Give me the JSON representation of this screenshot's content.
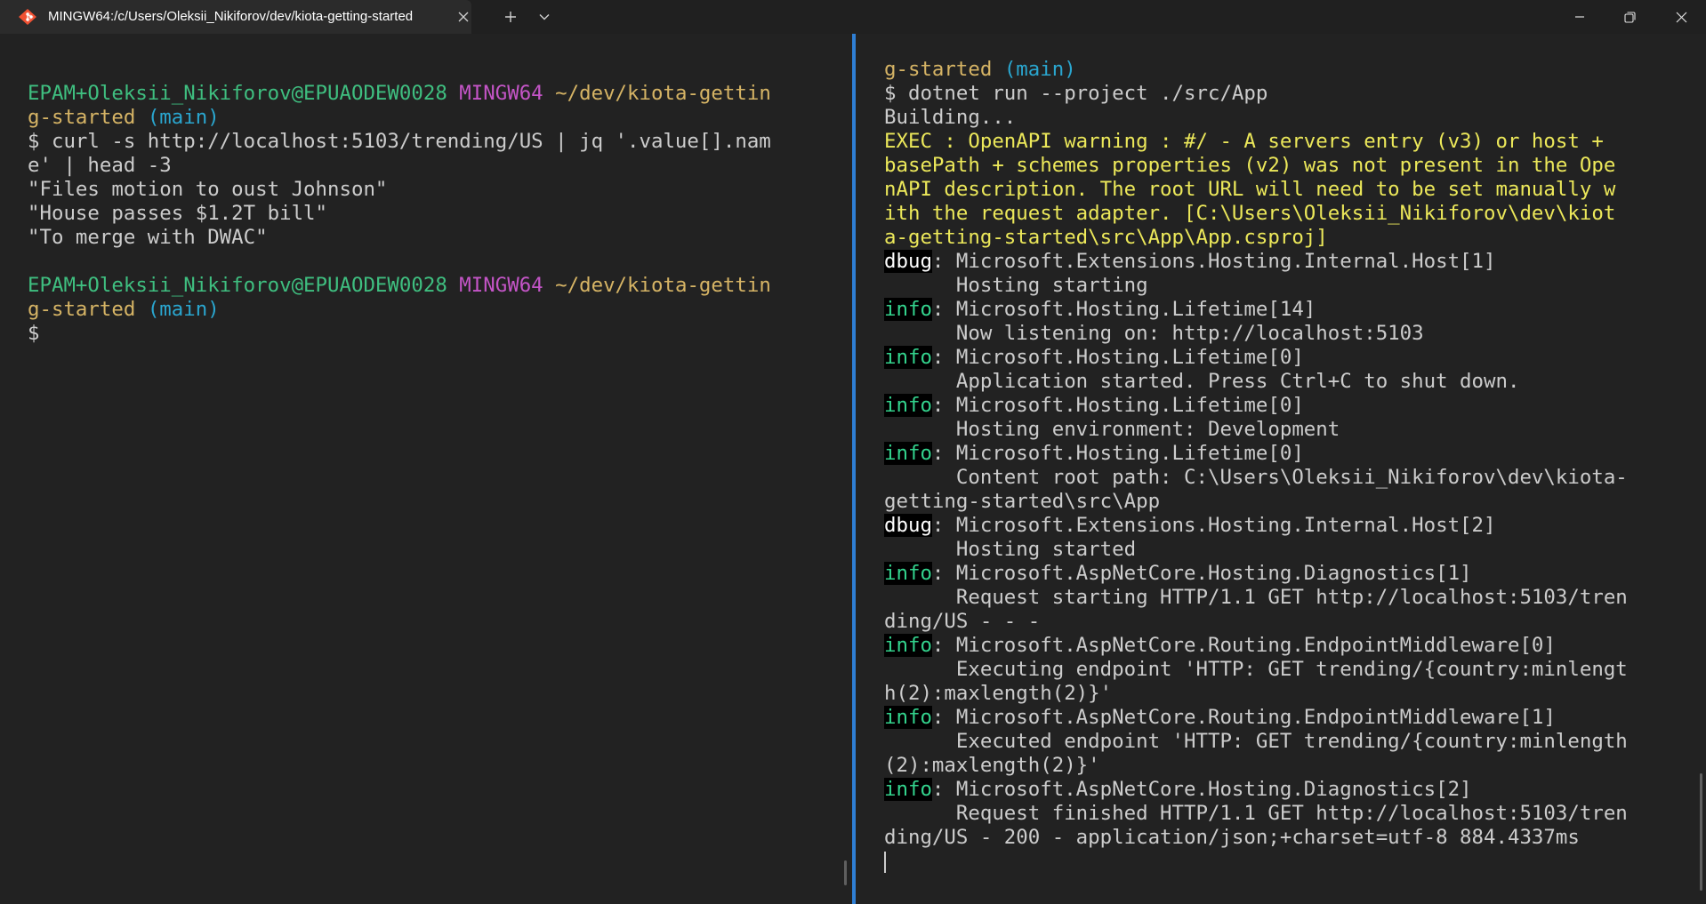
{
  "titlebar": {
    "tab_title": "MINGW64:/c/Users/Oleksii_Nikiforov/dev/kiota-getting-started",
    "tab_icon": "git-bash-icon",
    "new_tab_icon": "plus-icon",
    "tab_dropdown_icon": "chevron-down-icon",
    "minimize_icon": "minimize-icon",
    "maximize_icon": "restore-icon",
    "close_icon": "close-icon"
  },
  "left_pane": {
    "lines": [
      [],
      [],
      [
        {
          "t": "EPAM+Oleksii_Nikiforov@EPUAODEW0028",
          "c": "c-green"
        },
        {
          "t": " "
        },
        {
          "t": "MINGW64",
          "c": "c-magenta"
        },
        {
          "t": " "
        },
        {
          "t": "~/dev/kiota-gettin",
          "c": "c-yellow-dim"
        }
      ],
      [
        {
          "t": "g-started",
          "c": "c-yellow-dim"
        },
        {
          "t": " "
        },
        {
          "t": "(main)",
          "c": "c-cyan"
        }
      ],
      [
        {
          "t": "$ curl -s http://localhost:5103/trending/US | jq '.value[].nam"
        }
      ],
      [
        {
          "t": "e' | head -3"
        }
      ],
      [
        {
          "t": "\"Files motion to oust Johnson\""
        }
      ],
      [
        {
          "t": "\"House passes $1.2T bill\""
        }
      ],
      [
        {
          "t": "\"To merge with DWAC\""
        }
      ],
      [],
      [
        {
          "t": "EPAM+Oleksii_Nikiforov@EPUAODEW0028",
          "c": "c-green"
        },
        {
          "t": " "
        },
        {
          "t": "MINGW64",
          "c": "c-magenta"
        },
        {
          "t": " "
        },
        {
          "t": "~/dev/kiota-gettin",
          "c": "c-yellow-dim"
        }
      ],
      [
        {
          "t": "g-started",
          "c": "c-yellow-dim"
        },
        {
          "t": " "
        },
        {
          "t": "(main)",
          "c": "c-cyan"
        }
      ],
      [
        {
          "t": "$"
        }
      ]
    ]
  },
  "right_pane": {
    "lines": [
      [],
      [
        {
          "t": "g-started",
          "c": "c-yellow-dim"
        },
        {
          "t": " "
        },
        {
          "t": "(main)",
          "c": "c-cyan"
        }
      ],
      [
        {
          "t": "$ dotnet run --project ./src/App"
        }
      ],
      [
        {
          "t": "Building..."
        }
      ],
      [
        {
          "t": "EXEC : OpenAPI warning : #/ - A servers entry (v3) or host +",
          "c": "c-warn"
        }
      ],
      [
        {
          "t": "basePath + schemes properties (v2) was not present in the Ope",
          "c": "c-warn"
        }
      ],
      [
        {
          "t": "nAPI description. The root URL will need to be set manually w",
          "c": "c-warn"
        }
      ],
      [
        {
          "t": "ith the request adapter. [C:\\Users\\Oleksii_Nikiforov\\dev\\kiot",
          "c": "c-warn"
        }
      ],
      [
        {
          "t": "a-getting-started\\src\\App\\App.csproj]",
          "c": "c-warn"
        }
      ],
      [
        {
          "t": "dbug",
          "c": "badge-dbug"
        },
        {
          "t": ": Microsoft.Extensions.Hosting.Internal.Host[1]"
        }
      ],
      [
        {
          "t": "      Hosting starting"
        }
      ],
      [
        {
          "t": "info",
          "c": "badge-info"
        },
        {
          "t": ": Microsoft.Hosting.Lifetime[14]"
        }
      ],
      [
        {
          "t": "      Now listening on: http://localhost:5103"
        }
      ],
      [
        {
          "t": "info",
          "c": "badge-info"
        },
        {
          "t": ": Microsoft.Hosting.Lifetime[0]"
        }
      ],
      [
        {
          "t": "      Application started. Press Ctrl+C to shut down."
        }
      ],
      [
        {
          "t": "info",
          "c": "badge-info"
        },
        {
          "t": ": Microsoft.Hosting.Lifetime[0]"
        }
      ],
      [
        {
          "t": "      Hosting environment: Development"
        }
      ],
      [
        {
          "t": "info",
          "c": "badge-info"
        },
        {
          "t": ": Microsoft.Hosting.Lifetime[0]"
        }
      ],
      [
        {
          "t": "      Content root path: C:\\Users\\Oleksii_Nikiforov\\dev\\kiota-"
        }
      ],
      [
        {
          "t": "getting-started\\src\\App"
        }
      ],
      [
        {
          "t": "dbug",
          "c": "badge-dbug"
        },
        {
          "t": ": Microsoft.Extensions.Hosting.Internal.Host[2]"
        }
      ],
      [
        {
          "t": "      Hosting started"
        }
      ],
      [
        {
          "t": "info",
          "c": "badge-info"
        },
        {
          "t": ": Microsoft.AspNetCore.Hosting.Diagnostics[1]"
        }
      ],
      [
        {
          "t": "      Request starting HTTP/1.1 GET http://localhost:5103/tren"
        }
      ],
      [
        {
          "t": "ding/US - - -"
        }
      ],
      [
        {
          "t": "info",
          "c": "badge-info"
        },
        {
          "t": ": Microsoft.AspNetCore.Routing.EndpointMiddleware[0]"
        }
      ],
      [
        {
          "t": "      Executing endpoint 'HTTP: GET trending/{country:minlengt"
        }
      ],
      [
        {
          "t": "h(2):maxlength(2)}'"
        }
      ],
      [
        {
          "t": "info",
          "c": "badge-info"
        },
        {
          "t": ": Microsoft.AspNetCore.Routing.EndpointMiddleware[1]"
        }
      ],
      [
        {
          "t": "      Executed endpoint 'HTTP: GET trending/{country:minlength"
        }
      ],
      [
        {
          "t": "(2):maxlength(2)}'"
        }
      ],
      [
        {
          "t": "info",
          "c": "badge-info"
        },
        {
          "t": ": Microsoft.AspNetCore.Hosting.Diagnostics[2]"
        }
      ],
      [
        {
          "t": "      Request finished HTTP/1.1 GET http://localhost:5103/tren"
        }
      ],
      [
        {
          "t": "ding/US - 200 - application/json;+charset=utf-8 884.4337ms"
        }
      ]
    ]
  },
  "colors": {
    "prompt_user": "#3fbf80",
    "prompt_host": "#c455c7",
    "prompt_path": "#d6b465",
    "git_branch": "#2aa6cf",
    "warning": "#ece85a",
    "info_badge": "#33d38d",
    "pane_divider": "#2f7fd4",
    "background": "#222222"
  }
}
